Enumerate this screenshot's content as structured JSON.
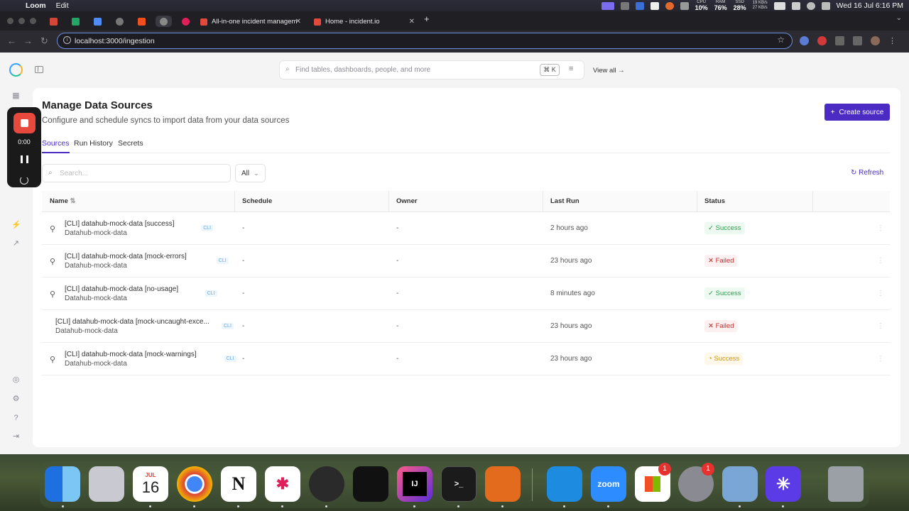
{
  "menubar": {
    "app_name": "Loom",
    "menus": [
      "Edit"
    ],
    "stats": {
      "cpu_label": "CPU",
      "cpu_value": "10%",
      "ram_label": "RAM",
      "ram_value": "76%",
      "ssd_label": "SSD",
      "ssd_value": "28%",
      "net_up": "19 KB/s",
      "net_down": "27 KB/s"
    },
    "datetime": "Wed 16 Jul  6:16 PM"
  },
  "browser": {
    "tabs": [
      {
        "title": "All-in-one incident managem"
      },
      {
        "title": "Home - incident.io"
      }
    ],
    "url": "localhost:3000/ingestion"
  },
  "app": {
    "global_search_placeholder": "Find tables, dashboards, people, and more",
    "shortcut": "⌘ K",
    "view_all": "View all →",
    "page_title": "Manage Data Sources",
    "page_subtitle": "Configure and schedule syncs to import data from your data sources",
    "create_button": "Create source",
    "tabs": [
      "Sources",
      "Run History",
      "Secrets"
    ],
    "search_placeholder": "Search...",
    "filter_value": "All",
    "refresh_label": "Refresh",
    "columns": [
      "Name",
      "Schedule",
      "Owner",
      "Last Run",
      "Status"
    ],
    "rows": [
      {
        "name": "[CLI] datahub-mock-data [success]",
        "sub": "Datahub-mock-data",
        "tag": "CLI",
        "schedule": "-",
        "owner": "-",
        "last_run": "2 hours ago",
        "status": "Success",
        "status_kind": "success",
        "icon": true
      },
      {
        "name": "[CLI] datahub-mock-data [mock-errors]",
        "sub": "Datahub-mock-data",
        "tag": "CLI",
        "schedule": "-",
        "owner": "-",
        "last_run": "23 hours ago",
        "status": "Failed",
        "status_kind": "failed",
        "icon": true
      },
      {
        "name": "[CLI] datahub-mock-data [no-usage]",
        "sub": "Datahub-mock-data",
        "tag": "CLI",
        "schedule": "-",
        "owner": "-",
        "last_run": "8 minutes ago",
        "status": "Success",
        "status_kind": "success",
        "icon": true
      },
      {
        "name": "[CLI] datahub-mock-data [mock-uncaught-exce...",
        "sub": "Datahub-mock-data",
        "tag": "CLI",
        "schedule": "-",
        "owner": "-",
        "last_run": "23 hours ago",
        "status": "Failed",
        "status_kind": "failed",
        "icon": false
      },
      {
        "name": "[CLI] datahub-mock-data [mock-warnings]",
        "sub": "Datahub-mock-data",
        "tag": "CLI",
        "schedule": "-",
        "owner": "-",
        "last_run": "23 hours ago",
        "status": "Success",
        "status_kind": "warn",
        "icon": true
      }
    ]
  },
  "loom": {
    "timer": "0:00"
  },
  "dock": {
    "calendar_month": "JUL",
    "calendar_day": "16",
    "zoom_label": "zoom",
    "office_badge": "1",
    "settings_badge": "1"
  },
  "colors": {
    "accent": "#4a2bc4",
    "success": "#2d9b4f",
    "failed": "#c42d2d",
    "warning": "#c9961a"
  }
}
